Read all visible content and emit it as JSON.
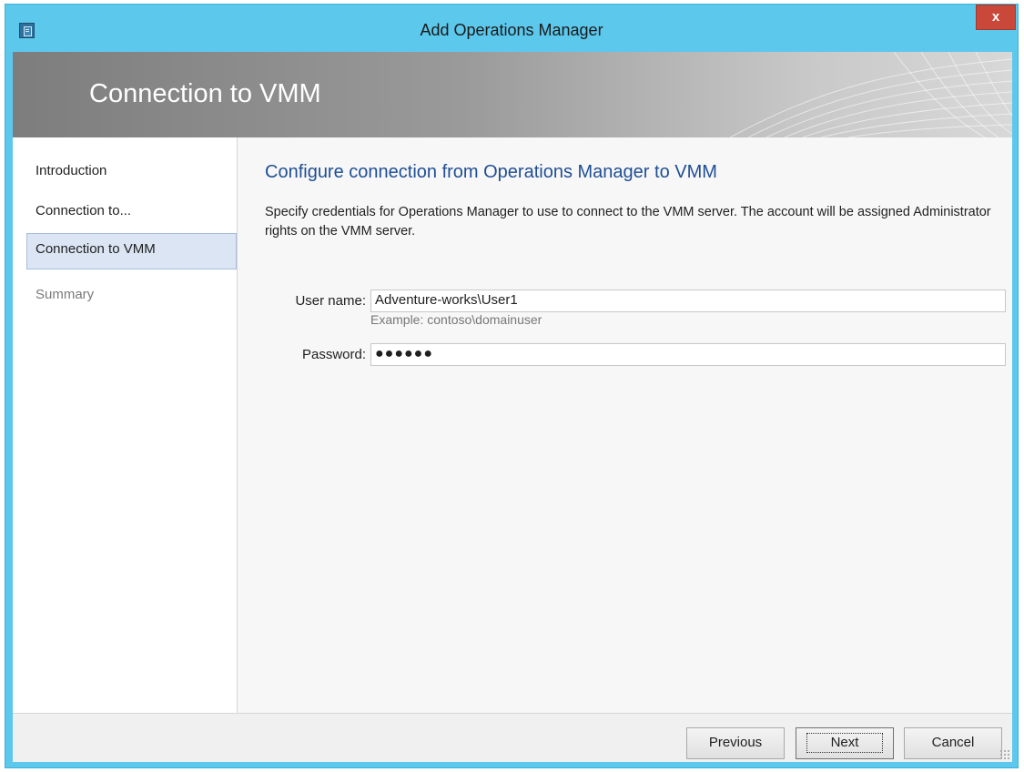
{
  "window": {
    "title": "Add Operations Manager",
    "close_label": "x"
  },
  "banner": {
    "title": "Connection to VMM"
  },
  "sidebar": {
    "items": [
      {
        "label": "Introduction",
        "state": "normal"
      },
      {
        "label": "Connection to...",
        "state": "normal"
      },
      {
        "label": "Connection to VMM",
        "state": "selected"
      },
      {
        "label": "Summary",
        "state": "disabled"
      }
    ]
  },
  "main": {
    "heading": "Configure connection from Operations Manager to VMM",
    "description": "Specify credentials for Operations Manager to use to connect to the VMM server. The account will be assigned Administrator rights on the VMM server.",
    "username": {
      "label": "User name:",
      "value": "Adventure-works\\User1",
      "hint": "Example: contoso\\domainuser"
    },
    "password": {
      "label": "Password:",
      "value": "●●●●●●"
    }
  },
  "footer": {
    "previous_label": "Previous",
    "next_label": "Next",
    "cancel_label": "Cancel"
  },
  "colors": {
    "titlebar": "#5cc8ec",
    "close_button": "#c9483a",
    "heading": "#1f4e94",
    "selected_nav": "#dbe5f3"
  }
}
